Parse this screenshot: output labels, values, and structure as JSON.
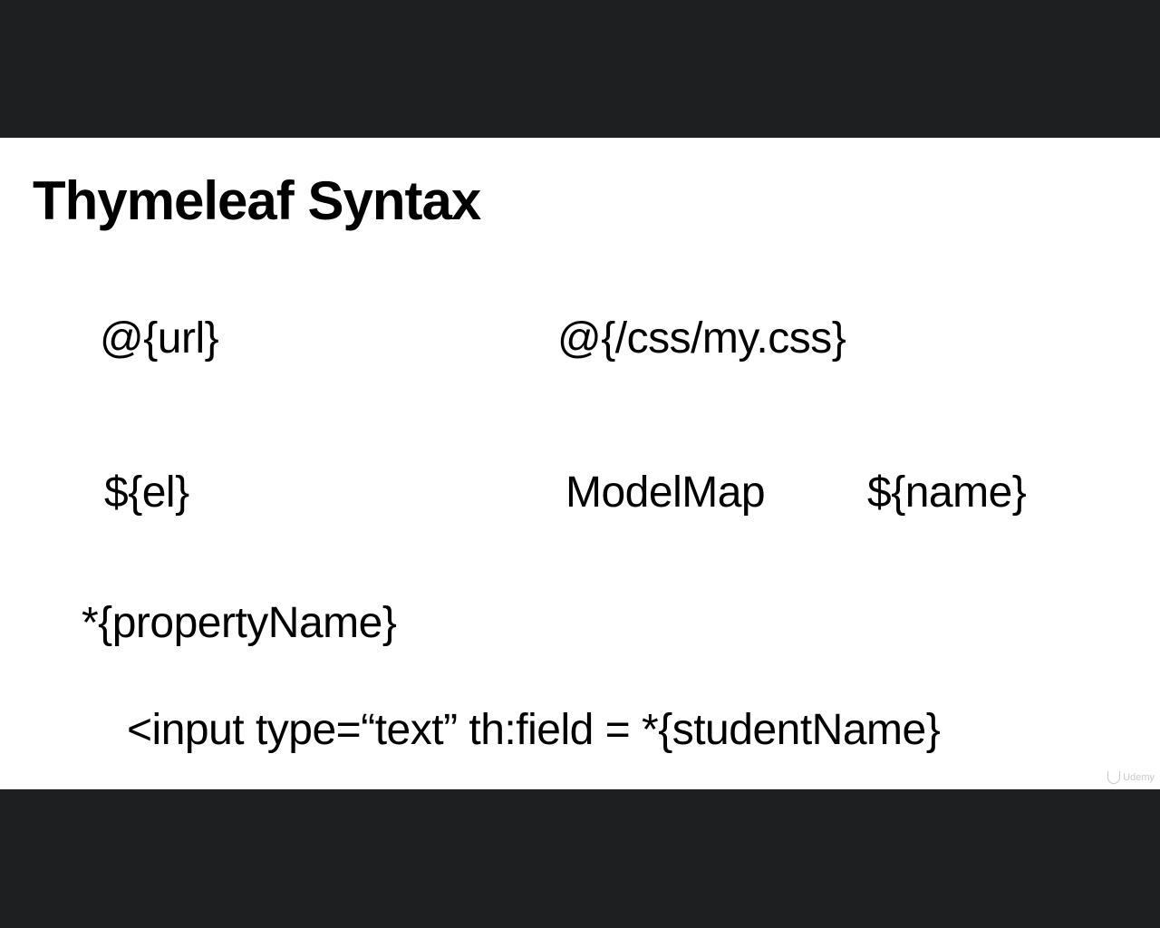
{
  "slide": {
    "title": "Thymeleaf Syntax",
    "items": {
      "url_expr": "@{url}",
      "css_expr": "@{/css/my.css}",
      "el_expr": "${el}",
      "modelmap": "ModelMap",
      "name_expr": "${name}",
      "property_expr": "*{propertyName}",
      "input_example": "<input type=“text” th:field = *{studentName}"
    },
    "watermark": "Udemy"
  },
  "colors": {
    "letterbox": "#1e1f21",
    "slide_background": "#ffffff",
    "text": "#000000"
  }
}
